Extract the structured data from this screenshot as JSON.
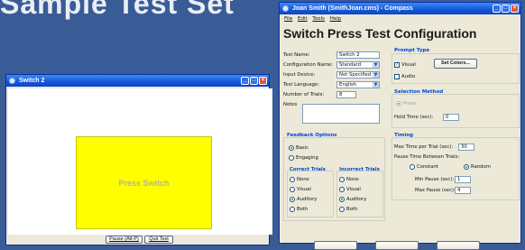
{
  "slide_heading": "Sample Test Set",
  "switch_window": {
    "title": "Switch 2",
    "switch_label": "Press Switch",
    "pause_button": "Pause (Alt-P)",
    "quit_button": "Quit Test"
  },
  "config_window": {
    "title": "Joan Smith (SmithJoan.cms) - Compass",
    "menu": [
      "File",
      "Edit",
      "Tools",
      "Help"
    ],
    "heading": "Switch Press Test Configuration",
    "test_name_label": "Test Name:",
    "test_name_value": "Switch 2",
    "config_name_label": "Configuration Name:",
    "config_name_value": "Standard",
    "input_device_label": "Input Device:",
    "input_device_value": "Not Specified",
    "test_language_label": "Test Language:",
    "test_language_value": "English",
    "num_trials_label": "Number of Trials:",
    "num_trials_value": "8",
    "notes_label": "Notes",
    "prompt_type": {
      "title": "Prompt Type",
      "visual": "Visual",
      "audio": "Audio",
      "set_colors": "Set Colors..."
    },
    "selection_method": {
      "title": "Selection Method",
      "press": "Press",
      "hold_time_label": "Hold Time (sec):",
      "hold_time_value": "0"
    },
    "feedback": {
      "title": "Feedback Options",
      "basic": "Basic",
      "engaging": "Engaging",
      "correct_title": "Correct Trials",
      "incorrect_title": "Incorrect Trials",
      "options": [
        "None",
        "Visual",
        "Auditory",
        "Both"
      ]
    },
    "timing": {
      "title": "Timing",
      "max_time_label": "Max Time per Trial (sec):",
      "max_time_value": "30",
      "pause_between_label": "Pause Time Between Trials:",
      "constant": "Constant",
      "random": "Random",
      "min_pause_label": "Min Pause (sec):",
      "min_pause_value": "1",
      "max_pause_label": "Max Pause (sec):",
      "max_pause_value": "4"
    }
  }
}
